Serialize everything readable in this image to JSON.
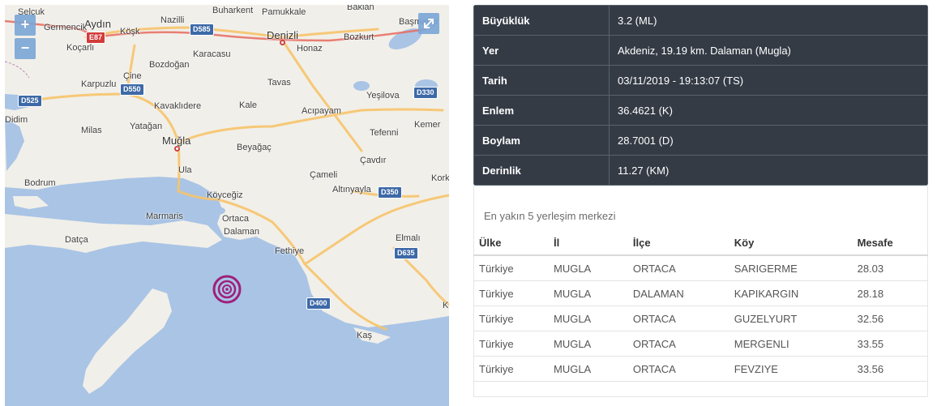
{
  "map": {
    "zoom_in_label": "+",
    "zoom_out_label": "−",
    "sea_color": "#a9c4e5",
    "land_color": "#f1efe9",
    "road_color": "#f7c46b",
    "epicenter_color": "#9e1f7a",
    "places": {
      "selcuk": "Selçuk",
      "aydin": "Aydın",
      "germencik": "Germencik",
      "kosk": "Köşk",
      "nazilli": "Nazilli",
      "buharkent": "Buharkent",
      "pamukkale": "Pamukkale",
      "baklan": "Baklan",
      "basmakci": "Başmakçı",
      "koçarli": "Koçarlı",
      "denizli": "Denizli",
      "bozkurt": "Bozkurt",
      "honaz": "Honaz",
      "karacasu": "Karacasu",
      "bozdogan": "Bozdoğan",
      "cine": "Çine",
      "karpuzlu": "Karpuzlu",
      "tavas": "Tavas",
      "yesilova": "Yeşilova",
      "kavaklidere": "Kavaklıdere",
      "kale": "Kale",
      "acipayam": "Acıpayam",
      "didim": "Didim",
      "milas": "Milas",
      "yatagan": "Yatağan",
      "mugla": "Muğla",
      "tefenni": "Tefenni",
      "kemer": "Kemer",
      "beyagac": "Beyağaç",
      "cavdir": "Çavdır",
      "ula": "Ula",
      "cameli": "Çameli",
      "korkuteli": "Kork",
      "bodrum": "Bodrum",
      "koycegiz": "Köyceğiz",
      "altinyayla": "Altınyayla",
      "marmaris": "Marmaris",
      "ortaca": "Ortaca",
      "dalaman": "Dalaman",
      "datca": "Datça",
      "elmali": "Elmalı",
      "fethiye": "Fethiye",
      "kas": "Kaş",
      "k": "K"
    },
    "shields": {
      "e87": "E87",
      "d585": "D585",
      "d550": "D550",
      "d525": "D525",
      "d330": "D330",
      "d350": "D350",
      "d635": "D635",
      "d400": "D400"
    }
  },
  "details": {
    "rows": [
      {
        "key": "Büyüklük",
        "value": "3.2 (ML)"
      },
      {
        "key": "Yer",
        "value": "Akdeniz, 19.19 km. Dalaman (Mugla)"
      },
      {
        "key": "Tarih",
        "value": "03/11/2019 - 19:13:07 (TS)"
      },
      {
        "key": "Enlem",
        "value": "36.4621 (K)"
      },
      {
        "key": "Boylam",
        "value": "28.7001 (D)"
      },
      {
        "key": "Derinlik",
        "value": "11.27 (KM)"
      }
    ]
  },
  "nearest": {
    "title": "En yakın 5 yerleşim merkezi",
    "headers": [
      "Ülke",
      "İl",
      "İlçe",
      "Köy",
      "Mesafe"
    ],
    "rows": [
      [
        "Türkiye",
        "MUGLA",
        "ORTACA",
        "SARIGERME",
        "28.03"
      ],
      [
        "Türkiye",
        "MUGLA",
        "DALAMAN",
        "KAPIKARGIN",
        "28.18"
      ],
      [
        "Türkiye",
        "MUGLA",
        "ORTACA",
        "GUZELYURT",
        "32.56"
      ],
      [
        "Türkiye",
        "MUGLA",
        "ORTACA",
        "MERGENLI",
        "33.55"
      ],
      [
        "Türkiye",
        "MUGLA",
        "ORTACA",
        "FEVZIYE",
        "33.56"
      ]
    ]
  }
}
